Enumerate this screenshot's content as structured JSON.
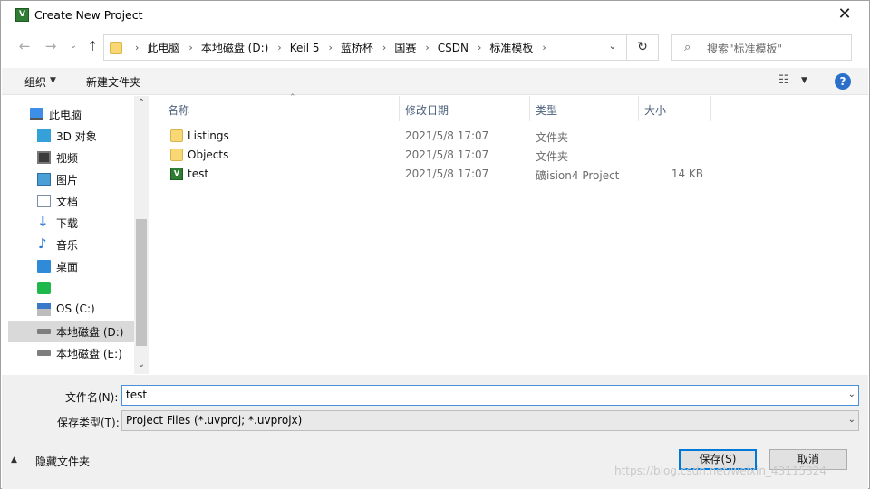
{
  "window": {
    "title": "Create New Project",
    "app_icon_text": "V"
  },
  "nav": {
    "breadcrumbs": [
      "此电脑",
      "本地磁盘 (D:)",
      "Keil 5",
      "蓝桥杯",
      "国赛",
      "CSDN",
      "标准模板"
    ],
    "search_placeholder": "搜索\"标准模板\""
  },
  "toolbar": {
    "organize_label": "组织",
    "new_folder_label": "新建文件夹",
    "help_label": "?"
  },
  "sidebar": {
    "items": [
      {
        "label": "此电脑",
        "icon": "computer-icon"
      },
      {
        "label": "3D 对象",
        "icon": "3d-objects-icon"
      },
      {
        "label": "视频",
        "icon": "video-icon"
      },
      {
        "label": "图片",
        "icon": "pictures-icon"
      },
      {
        "label": "文档",
        "icon": "documents-icon"
      },
      {
        "label": "下载",
        "icon": "download-icon"
      },
      {
        "label": "音乐",
        "icon": "music-icon"
      },
      {
        "label": "桌面",
        "icon": "desktop-icon"
      },
      {
        "label": "",
        "icon": "app-shortcut-icon"
      },
      {
        "label": "OS (C:)",
        "icon": "os-drive-icon"
      },
      {
        "label": "本地磁盘 (D:)",
        "icon": "drive-icon",
        "selected": true
      },
      {
        "label": "本地磁盘 (E:)",
        "icon": "drive-icon"
      }
    ]
  },
  "filelist": {
    "columns": [
      "名称",
      "修改日期",
      "类型",
      "大小"
    ],
    "rows": [
      {
        "name": "Listings",
        "date": "2021/5/8 17:07",
        "type": "文件夹",
        "size": "",
        "icon": "folder-icon"
      },
      {
        "name": "Objects",
        "date": "2021/5/8 17:07",
        "type": "文件夹",
        "size": "",
        "icon": "folder-icon"
      },
      {
        "name": "test",
        "date": "2021/5/8 17:07",
        "type": "礦ision4 Project",
        "size": "14 KB",
        "icon": "uvision-project-icon"
      }
    ]
  },
  "form": {
    "filename_label": "文件名(N):",
    "filename_value": "test",
    "filetype_label": "保存类型(T):",
    "filetype_value": "Project Files (*.uvproj; *.uvprojx)",
    "hide_folders_label": "隐藏文件夹",
    "save_label": "保存(S)",
    "cancel_label": "取消"
  },
  "watermark": "https://blog.csdn.net/weixin_43115324",
  "colors": {
    "accent": "#0078d7",
    "selected_row": "#d9d9d9",
    "folder": "#f8d774"
  }
}
